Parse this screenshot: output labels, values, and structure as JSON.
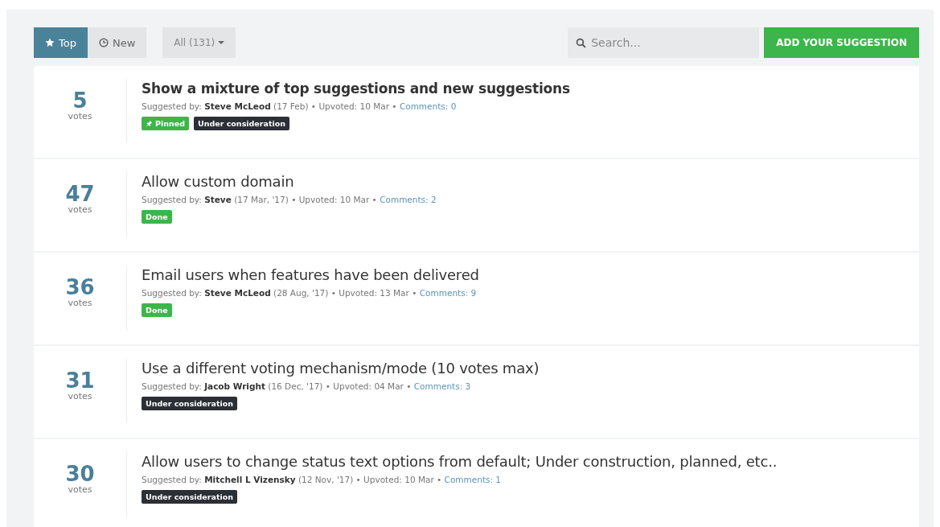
{
  "toolbar": {
    "sort_tabs": [
      {
        "label": "Top",
        "selected": true
      },
      {
        "label": "New",
        "selected": false
      }
    ],
    "filter": {
      "label": "All (131)"
    },
    "search": {
      "placeholder": "Search..."
    },
    "add_button": {
      "label": "ADD YOUR SUGGESTION"
    }
  },
  "suggestions": [
    {
      "votes": "5",
      "votes_label": "votes",
      "title": "Show a mixture of top suggestions and new suggestions",
      "pinned": true,
      "meta": "Suggested by: **Steve McLeod** (17 Feb) • Upvoted: 10 Mar • ",
      "comments": "Comments: 0",
      "tags": [
        {
          "kind": "pinned",
          "label": "Pinned",
          "color": "#3cb54a"
        },
        {
          "kind": "status",
          "label": "Under consideration",
          "color": "#2b2f36"
        }
      ]
    },
    {
      "votes": "47",
      "votes_label": "votes",
      "title": "Allow custom domain",
      "pinned": false,
      "meta": "Suggested by: **Steve** (17 Mar, '17) • Upvoted: 10 Mar • ",
      "comments": "Comments: 2",
      "tags": [
        {
          "kind": "status",
          "label": "Done",
          "color": "#3cb54a"
        }
      ]
    },
    {
      "votes": "36",
      "votes_label": "votes",
      "title": "Email users when features have been delivered",
      "pinned": false,
      "meta": "Suggested by: **Steve McLeod** (28 Aug, '17) • Upvoted: 13 Mar • ",
      "comments": "Comments: 9",
      "tags": [
        {
          "kind": "status",
          "label": "Done",
          "color": "#3cb54a"
        }
      ]
    },
    {
      "votes": "31",
      "votes_label": "votes",
      "title": "Use a different voting mechanism/mode (10 votes max)",
      "pinned": false,
      "meta": "Suggested by: **Jacob Wright** (16 Dec, '17) • Upvoted: 04 Mar • ",
      "comments": "Comments: 3",
      "tags": [
        {
          "kind": "status",
          "label": "Under consideration",
          "color": "#2b2f36"
        }
      ]
    },
    {
      "votes": "30",
      "votes_label": "votes",
      "title": "Allow users to change status text options from default; Under construction, planned, etc..",
      "pinned": false,
      "meta": "Suggested by: **Mitchell L Vizensky** (12 Nov, '17) • Upvoted: 10 Mar • ",
      "comments": "Comments: 1",
      "tags": [
        {
          "kind": "status",
          "label": "Under consideration",
          "color": "#2b2f36"
        }
      ]
    }
  ]
}
